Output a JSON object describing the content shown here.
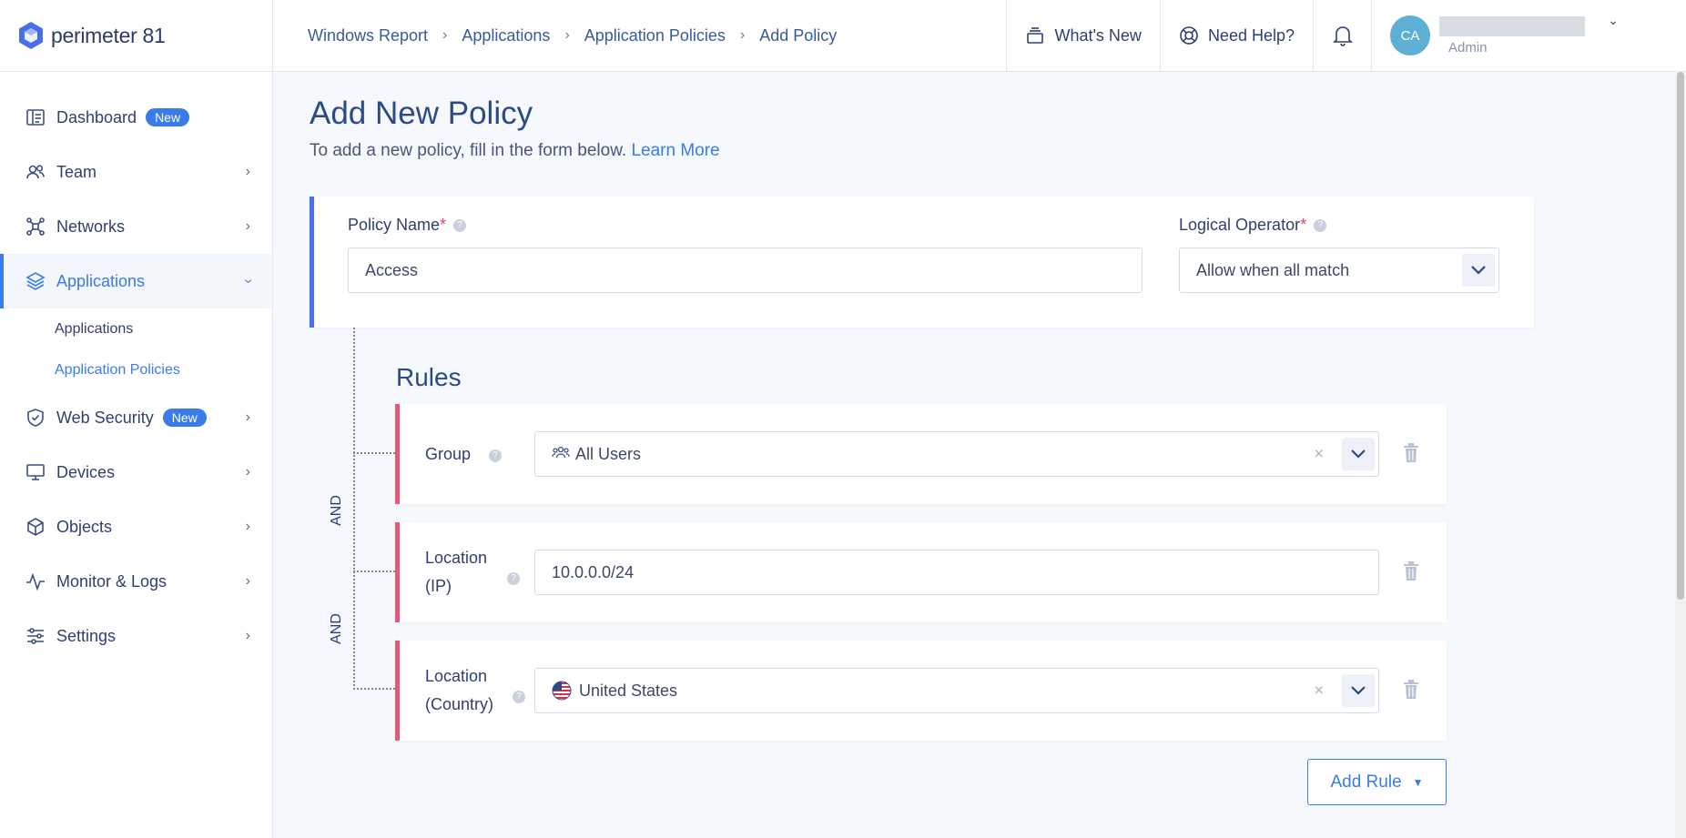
{
  "brand": {
    "name": "perimeter 81",
    "accent": "#3a7bea"
  },
  "sidebar": {
    "items": [
      {
        "label": "Dashboard",
        "badge": "New",
        "icon": "dashboard-icon"
      },
      {
        "label": "Team",
        "icon": "team-icon"
      },
      {
        "label": "Networks",
        "icon": "network-icon"
      },
      {
        "label": "Applications",
        "icon": "layers-icon",
        "active": true
      },
      {
        "label": "Web Security",
        "badge": "New",
        "icon": "shield-icon"
      },
      {
        "label": "Devices",
        "icon": "monitor-icon"
      },
      {
        "label": "Objects",
        "icon": "cube-icon"
      },
      {
        "label": "Monitor & Logs",
        "icon": "activity-icon"
      },
      {
        "label": "Settings",
        "icon": "sliders-icon"
      }
    ],
    "sub_items": [
      {
        "label": "Applications"
      },
      {
        "label": "Application Policies",
        "active": true
      }
    ]
  },
  "header": {
    "breadcrumbs": [
      "Windows Report",
      "Applications",
      "Application Policies",
      "Add Policy"
    ],
    "whats_new": "What's New",
    "need_help": "Need Help?",
    "user": {
      "initials": "CA",
      "role": "Admin"
    }
  },
  "main": {
    "title": "Add New Policy",
    "subtitle": "To add a new policy, fill in the form below.",
    "learn_more": "Learn More",
    "policy_name": {
      "label": "Policy Name",
      "value": "Access"
    },
    "logical_operator": {
      "label": "Logical Operator",
      "value": "Allow when all match"
    },
    "rules_title": "Rules",
    "connector": "AND",
    "rules": [
      {
        "label": "Group",
        "value": "All Users",
        "type": "select"
      },
      {
        "label": "Location (IP)",
        "value": "10.0.0.0/24",
        "type": "text"
      },
      {
        "label": "Location (Country)",
        "value": "United States",
        "type": "select"
      }
    ],
    "add_rule": "Add Rule"
  }
}
